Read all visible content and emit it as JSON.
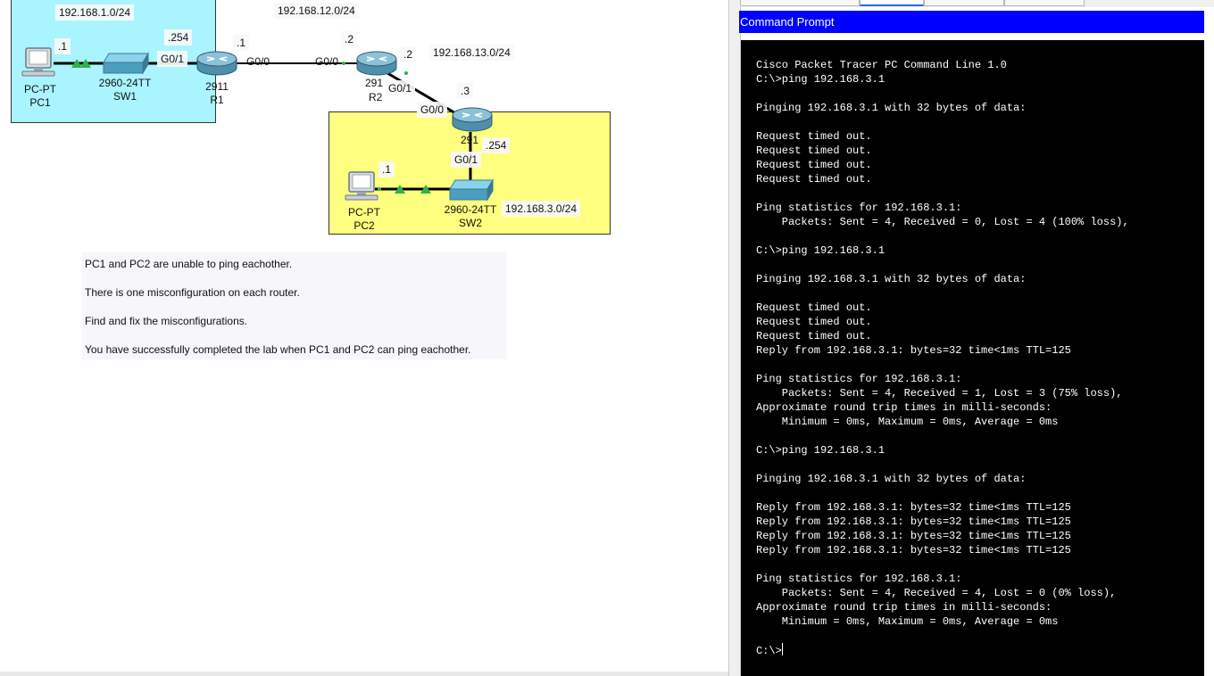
{
  "workspace": {
    "networks": {
      "lan1": "192.168.1.0/24",
      "wan12": "192.168.12.0/24",
      "wan13": "192.168.13.0/24",
      "lan3": "192.168.3.0/24"
    },
    "devices": {
      "pc1": {
        "type": "PC-PT",
        "name": "PC1",
        "ip_suffix": ".1"
      },
      "sw1": {
        "model": "2960-24TT",
        "name": "SW1"
      },
      "r1": {
        "model": "2911",
        "name": "R1",
        "lan_suffix": ".254",
        "lan_if": "G0/1",
        "wan_suffix": ".1",
        "wan_if": "G0/0"
      },
      "r2": {
        "model": "291",
        "name": "R2",
        "wan_in_if": "G0/0",
        "wan_in_suffix": ".2",
        "wan_out_suffix": ".2",
        "wan_out_if": "G0/1"
      },
      "r3": {
        "model": "291",
        "wan_if": "G0/0",
        "wan_suffix": ".3",
        "lan_suffix": ".254",
        "lan_if": "G0/1"
      },
      "pc2": {
        "type": "PC-PT",
        "name": "PC2",
        "ip_suffix": ".1"
      },
      "sw2": {
        "model": "2960-24TT",
        "name": "SW2"
      }
    },
    "instructions": [
      "PC1 and PC2 are unable to ping eachother.",
      "There is one misconfiguration on each router.",
      "Find and fix the misconfigurations.",
      "You have successfully completed the lab when PC1 and PC2 can ping eachother."
    ]
  },
  "cmd": {
    "title": "Command Prompt",
    "lines": [
      "Cisco Packet Tracer PC Command Line 1.0",
      "C:\\>ping 192.168.3.1",
      "",
      "Pinging 192.168.3.1 with 32 bytes of data:",
      "",
      "Request timed out.",
      "Request timed out.",
      "Request timed out.",
      "Request timed out.",
      "",
      "Ping statistics for 192.168.3.1:",
      "    Packets: Sent = 4, Received = 0, Lost = 4 (100% loss),",
      "",
      "C:\\>ping 192.168.3.1",
      "",
      "Pinging 192.168.3.1 with 32 bytes of data:",
      "",
      "Request timed out.",
      "Request timed out.",
      "Request timed out.",
      "Reply from 192.168.3.1: bytes=32 time<1ms TTL=125",
      "",
      "Ping statistics for 192.168.3.1:",
      "    Packets: Sent = 4, Received = 1, Lost = 3 (75% loss),",
      "Approximate round trip times in milli-seconds:",
      "    Minimum = 0ms, Maximum = 0ms, Average = 0ms",
      "",
      "C:\\>ping 192.168.3.1",
      "",
      "Pinging 192.168.3.1 with 32 bytes of data:",
      "",
      "Reply from 192.168.3.1: bytes=32 time<1ms TTL=125",
      "Reply from 192.168.3.1: bytes=32 time<1ms TTL=125",
      "Reply from 192.168.3.1: bytes=32 time<1ms TTL=125",
      "Reply from 192.168.3.1: bytes=32 time<1ms TTL=125",
      "",
      "Ping statistics for 192.168.3.1:",
      "    Packets: Sent = 4, Received = 4, Lost = 0 (0% loss),",
      "Approximate round trip times in milli-seconds:",
      "    Minimum = 0ms, Maximum = 0ms, Average = 0ms",
      ""
    ],
    "prompt": "C:\\>"
  },
  "colors": {
    "lan1_area": "#aaf4ff",
    "lan3_area": "#ffff80",
    "titlebar": "#0000ff",
    "console_bg": "#000000",
    "console_fg": "#ffffff",
    "link_up": "#2fb24a"
  }
}
